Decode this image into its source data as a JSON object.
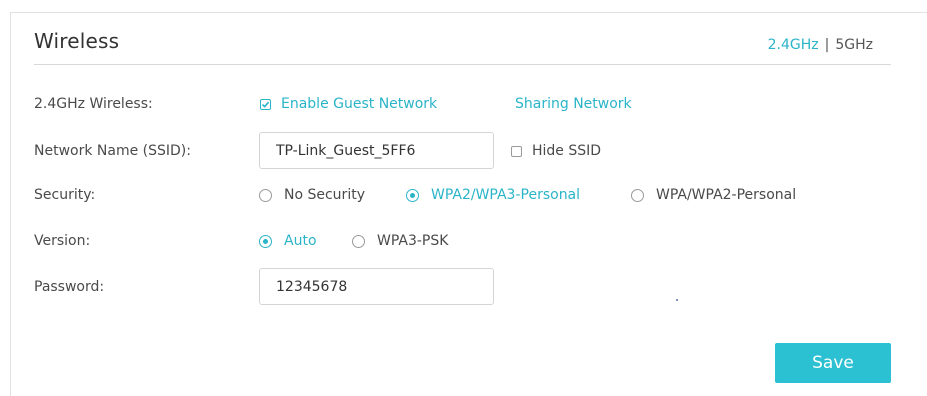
{
  "panel": {
    "title": "Wireless",
    "bands": {
      "band_24": "2.4GHz",
      "separator": "|",
      "band_5": "5GHz",
      "active": "2.4GHz"
    }
  },
  "form": {
    "wireless_row": {
      "label": "2.4GHz Wireless:",
      "enable_guest": {
        "label": "Enable Guest Network",
        "checked": true
      },
      "sharing_link": "Sharing Network"
    },
    "ssid_row": {
      "label": "Network Name (SSID):",
      "value": "TP-Link_Guest_5FF6",
      "hide_ssid": {
        "label": "Hide SSID",
        "checked": false
      }
    },
    "security_row": {
      "label": "Security:",
      "options": [
        {
          "label": "No Security",
          "selected": false
        },
        {
          "label": "WPA2/WPA3-Personal",
          "selected": true
        },
        {
          "label": "WPA/WPA2-Personal",
          "selected": false
        }
      ]
    },
    "version_row": {
      "label": "Version:",
      "options": [
        {
          "label": "Auto",
          "selected": true
        },
        {
          "label": "WPA3-PSK",
          "selected": false
        }
      ]
    },
    "password_row": {
      "label": "Password:",
      "value": "12345678"
    }
  },
  "actions": {
    "save_label": "Save"
  },
  "colors": {
    "accent": "#2ab4c8",
    "button": "#2bc0d2",
    "text": "#4a4a4a",
    "border": "#d5d5d5"
  },
  "icons": {
    "checkbox_checked": "checkmark-icon",
    "checkbox_unchecked": "checkbox-empty-icon",
    "radio_selected": "radio-selected-icon",
    "radio_unselected": "radio-empty-icon"
  }
}
